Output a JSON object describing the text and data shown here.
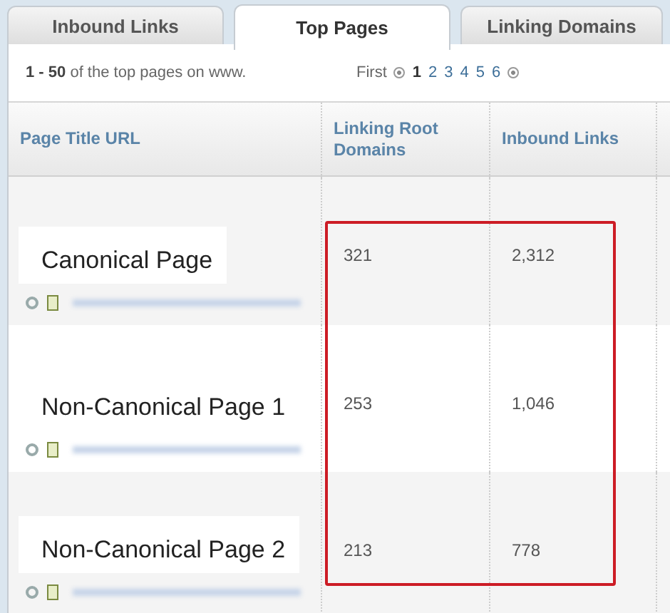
{
  "tabs": [
    {
      "label": "Inbound Links",
      "selected": false
    },
    {
      "label": "Top Pages",
      "selected": true
    },
    {
      "label": "Linking Domains",
      "selected": false
    }
  ],
  "summary": {
    "range": "1 - 50",
    "text": "of the top pages on www."
  },
  "pagination": {
    "first": "First",
    "pages": [
      {
        "label": "1",
        "selected": true
      },
      {
        "label": "2",
        "selected": false
      },
      {
        "label": "3",
        "selected": false
      },
      {
        "label": "4",
        "selected": false
      },
      {
        "label": "5",
        "selected": false
      },
      {
        "label": "6",
        "selected": false
      }
    ]
  },
  "table": {
    "columns": [
      "Page Title URL",
      "Linking Root Domains",
      "Inbound Links"
    ],
    "rows": [
      {
        "title": "Canonical Page",
        "linking_root_domains": "321",
        "inbound_links": "2,312"
      },
      {
        "title": "Non-Canonical Page 1",
        "linking_root_domains": "253",
        "inbound_links": "1,046"
      },
      {
        "title": "Non-Canonical Page 2",
        "linking_root_domains": "213",
        "inbound_links": "778"
      }
    ]
  },
  "highlight": {
    "kind": "frame"
  }
}
